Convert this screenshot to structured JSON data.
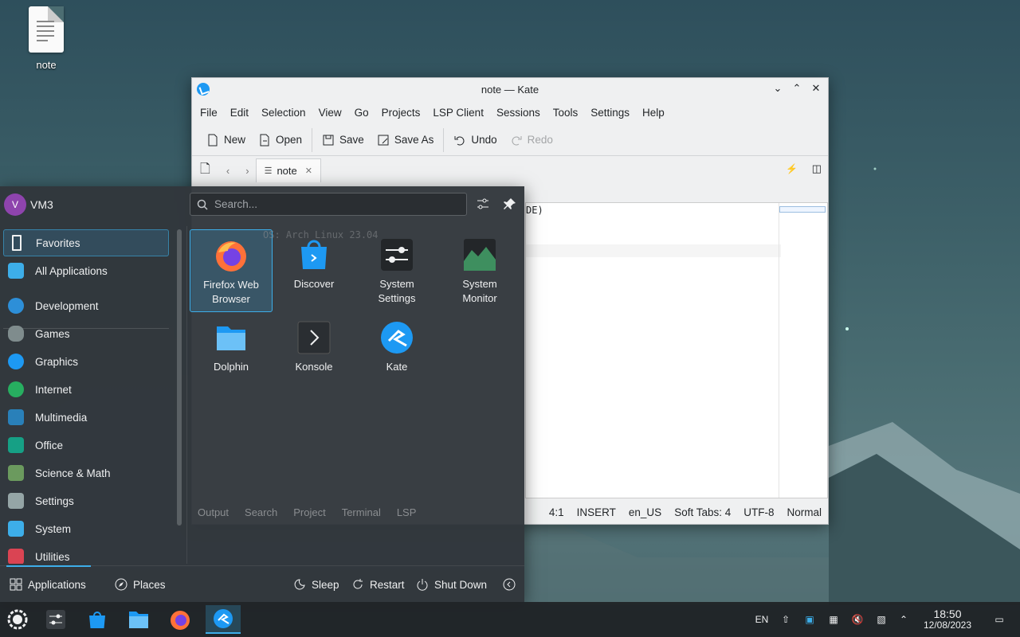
{
  "desktop": {
    "icon_label": "note"
  },
  "kate": {
    "title": "note — Kate",
    "menu": [
      "File",
      "Edit",
      "Selection",
      "View",
      "Go",
      "Projects",
      "LSP Client",
      "Sessions",
      "Tools",
      "Settings",
      "Help"
    ],
    "toolbar": {
      "new": "New",
      "open": "Open",
      "save": "Save",
      "save_as": "Save As",
      "undo": "Undo",
      "redo": "Redo"
    },
    "tab_label": "note",
    "editor_fragment": "DE)",
    "bottom_tabs": [
      "Output",
      "Search",
      "Project",
      "Terminal",
      "LSP"
    ],
    "status": {
      "position": "4:1",
      "mode": "INSERT",
      "language": "en_US",
      "tabs": "Soft Tabs: 4",
      "encoding": "UTF-8",
      "input": "Normal"
    },
    "ghost_text": [
      "OS: Arch Linux 23.04"
    ]
  },
  "launcher": {
    "user": {
      "initial": "V",
      "name": "VM3"
    },
    "search_placeholder": "Search...",
    "categories": [
      {
        "label": "Favorites",
        "color": "#3daee9",
        "selected": true
      },
      {
        "label": "All Applications",
        "color": "#3daee9",
        "selected": false
      },
      {
        "label": "Development",
        "color": "#2d8fd8",
        "selected": false
      },
      {
        "label": "Games",
        "color": "#7f8c8d",
        "selected": false
      },
      {
        "label": "Graphics",
        "color": "#1d99f3",
        "selected": false
      },
      {
        "label": "Internet",
        "color": "#27ae60",
        "selected": false
      },
      {
        "label": "Multimedia",
        "color": "#2980b9",
        "selected": false
      },
      {
        "label": "Office",
        "color": "#16a085",
        "selected": false
      },
      {
        "label": "Science & Math",
        "color": "#6b9a5e",
        "selected": false
      },
      {
        "label": "Settings",
        "color": "#95a5a6",
        "selected": false
      },
      {
        "label": "System",
        "color": "#3daee9",
        "selected": false
      },
      {
        "label": "Utilities",
        "color": "#da4453",
        "selected": false
      }
    ],
    "apps": [
      {
        "line1": "Firefox Web",
        "line2": "Browser",
        "icon": "firefox-icon",
        "selected": true
      },
      {
        "line1": "Discover",
        "line2": "",
        "icon": "discover-icon",
        "selected": false
      },
      {
        "line1": "System",
        "line2": "Settings",
        "icon": "system-settings-icon",
        "selected": false
      },
      {
        "line1": "System",
        "line2": "Monitor",
        "icon": "system-monitor-icon",
        "selected": false
      },
      {
        "line1": "Dolphin",
        "line2": "",
        "icon": "dolphin-icon",
        "selected": false
      },
      {
        "line1": "Konsole",
        "line2": "",
        "icon": "konsole-icon",
        "selected": false
      },
      {
        "line1": "Kate",
        "line2": "",
        "icon": "kate-icon",
        "selected": false
      }
    ],
    "footer": {
      "applications": "Applications",
      "places": "Places",
      "sleep": "Sleep",
      "restart": "Restart",
      "shutdown": "Shut Down"
    }
  },
  "taskbar": {
    "tray": {
      "lang": "EN"
    },
    "clock": {
      "time": "18:50",
      "date": "12/08/2023"
    }
  },
  "colors": {
    "accent": "#3daee9",
    "panel": "#31363b",
    "window": "#eff0f1"
  }
}
